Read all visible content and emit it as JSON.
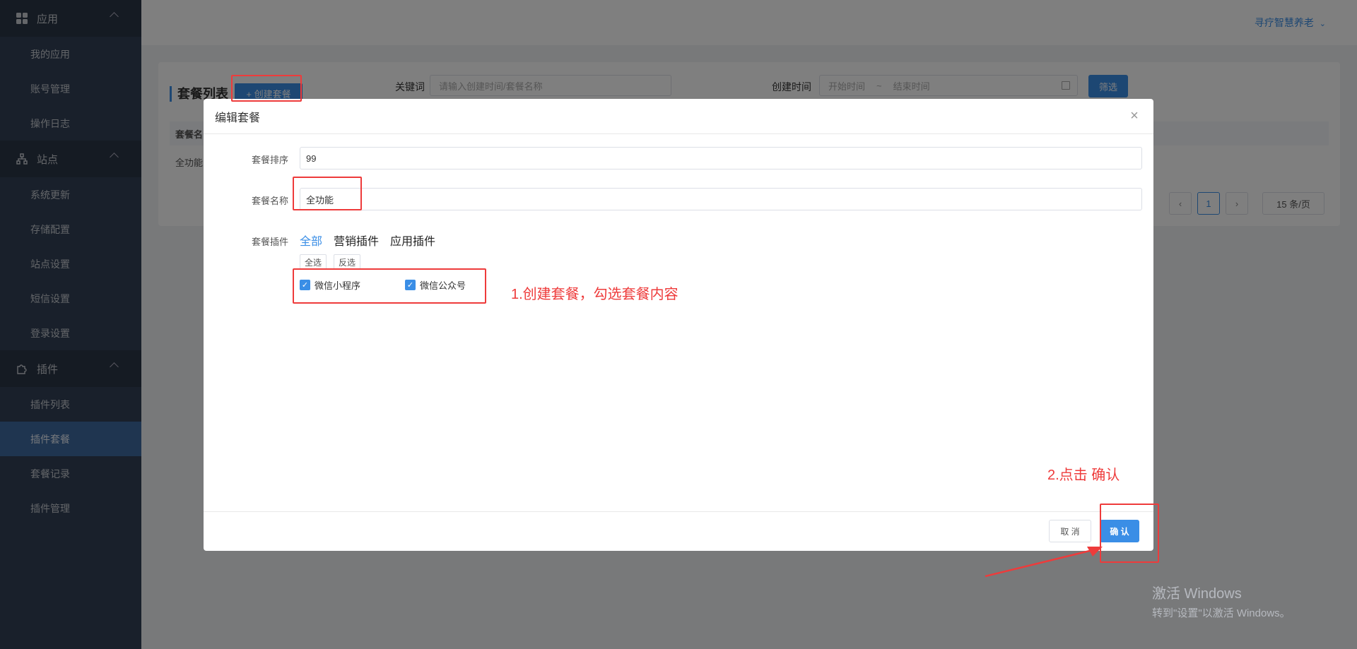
{
  "sidebar": {
    "groups": [
      {
        "label": "应用",
        "items": [
          "我的应用",
          "账号管理",
          "操作日志"
        ]
      },
      {
        "label": "站点",
        "items": [
          "系统更新",
          "存储配置",
          "站点设置",
          "短信设置",
          "登录设置"
        ]
      },
      {
        "label": "插件",
        "items": [
          "插件列表",
          "插件套餐",
          "套餐记录",
          "插件管理"
        ]
      }
    ],
    "active_item": "插件套餐"
  },
  "header": {
    "user": "寻疗智慧养老"
  },
  "main": {
    "title": "套餐列表",
    "create_button": "+ 创建套餐",
    "keyword_label": "关键词",
    "keyword_placeholder": "请输入创建时间/套餐名称",
    "time_label": "创建时间",
    "start_placeholder": "开始时间",
    "range_sep": "~",
    "end_placeholder": "结束时间",
    "filter_button": "筛选",
    "table_header": "套餐名",
    "row_text": "全功能",
    "page_current": "1",
    "page_size": "15 条/页"
  },
  "modal": {
    "title": "编辑套餐",
    "sort_label": "套餐排序",
    "sort_value": "99",
    "name_label": "套餐名称",
    "name_value": "全功能",
    "plugin_label": "套餐插件",
    "tabs": [
      "全部",
      "营销插件",
      "应用插件"
    ],
    "select_all": "全选",
    "invert": "反选",
    "plugins": [
      "微信小程序",
      "微信公众号"
    ],
    "cancel": "取 消",
    "confirm": "确 认"
  },
  "annotations": {
    "step1": "1.创建套餐，勾选套餐内容",
    "step2": "2.点击 确认"
  },
  "watermark": {
    "line1": "激活 Windows",
    "line2": "转到\"设置\"以激活 Windows。"
  },
  "colors": {
    "accent": "#3a8ee6",
    "sidebar": "#324157",
    "annotation": "#ee3b3b"
  }
}
